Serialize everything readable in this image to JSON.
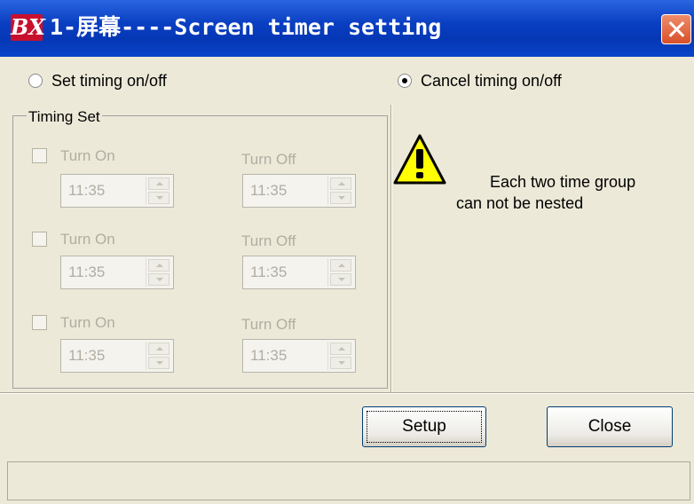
{
  "window": {
    "logo_text": "BX",
    "title": "1-屏幕----Screen timer setting"
  },
  "mode": {
    "set_label": "Set timing on/off",
    "cancel_label": "Cancel timing on/off",
    "selected": "cancel"
  },
  "timing_set": {
    "title": "Timing Set",
    "groups": [
      {
        "on_label": "Turn On",
        "off_label": "Turn Off",
        "on_time": "11:35",
        "off_time": "11:35"
      },
      {
        "on_label": "Turn On",
        "off_label": "Turn Off",
        "on_time": "11:35",
        "off_time": "11:35"
      },
      {
        "on_label": "Turn On",
        "off_label": "Turn Off",
        "on_time": "11:35",
        "off_time": "11:35"
      }
    ]
  },
  "warning": {
    "line1": "Each two time group",
    "line2": "can not be nested",
    "icon": "warning-icon"
  },
  "buttons": {
    "setup": "Setup",
    "close": "Close"
  },
  "colors": {
    "titlebar": "#0a3fc2",
    "close": "#d8502a",
    "warning": "#ffff00"
  }
}
